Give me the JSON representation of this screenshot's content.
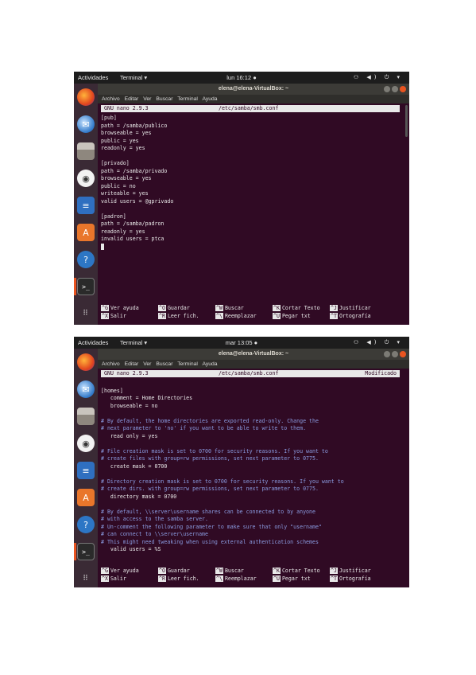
{
  "screens": [
    {
      "topbar": {
        "activities": "Actividades",
        "app_menu": "Terminal ▾",
        "clock": "lun 16:12 ●",
        "tray": "⚇ ◀) ⏻ ▾"
      },
      "window": {
        "title": "elena@elena-VirtualBox: ~"
      },
      "menubar": [
        "Archivo",
        "Editar",
        "Ver",
        "Buscar",
        "Terminal",
        "Ayuda"
      ],
      "nano": {
        "version": "GNU nano 2.9.3",
        "file": "/etc/samba/smb.conf",
        "status": "",
        "lines": [
          {
            "text": "[pub]",
            "comment": false
          },
          {
            "text": "path = /samba/publico",
            "comment": false
          },
          {
            "text": "browseable = yes",
            "comment": false
          },
          {
            "text": "public = yes",
            "comment": false
          },
          {
            "text": "readonly = yes",
            "comment": false
          },
          {
            "text": "",
            "comment": false
          },
          {
            "text": "[privado]",
            "comment": false
          },
          {
            "text": "path = /samba/privado",
            "comment": false
          },
          {
            "text": "browseable = yes",
            "comment": false
          },
          {
            "text": "public = no",
            "comment": false
          },
          {
            "text": "writeable = yes",
            "comment": false
          },
          {
            "text": "valid users = @gprivado",
            "comment": false
          },
          {
            "text": "",
            "comment": false
          },
          {
            "text": "[padron]",
            "comment": false
          },
          {
            "text": "path = /samba/padron",
            "comment": false
          },
          {
            "text": "readonly = yes",
            "comment": false
          },
          {
            "text": "invalid users = ptca",
            "comment": false
          }
        ],
        "cursor_after_last": true,
        "shortcuts": [
          {
            "key": "^G",
            "label": "Ver ayuda"
          },
          {
            "key": "^O",
            "label": "Guardar"
          },
          {
            "key": "^W",
            "label": "Buscar"
          },
          {
            "key": "^K",
            "label": "Cortar Texto"
          },
          {
            "key": "^J",
            "label": "Justificar"
          },
          {
            "key": "^X",
            "label": "Salir"
          },
          {
            "key": "^R",
            "label": "Leer fich."
          },
          {
            "key": "^\\",
            "label": "Reemplazar"
          },
          {
            "key": "^U",
            "label": "Pegar txt"
          },
          {
            "key": "^T",
            "label": "Ortografía"
          }
        ]
      }
    },
    {
      "topbar": {
        "activities": "Actividades",
        "app_menu": "Terminal ▾",
        "clock": "mar 13:05 ●",
        "tray": "⚇ ◀) ⏻ ▾"
      },
      "window": {
        "title": "elena@elena-VirtualBox: ~"
      },
      "menubar": [
        "Archivo",
        "Editar",
        "Ver",
        "Buscar",
        "Terminal",
        "Ayuda"
      ],
      "nano": {
        "version": "GNU nano 2.9.3",
        "file": "/etc/samba/smb.conf",
        "status": "Modificado",
        "lines": [
          {
            "text": "",
            "comment": false
          },
          {
            "text": "[homes]",
            "comment": false
          },
          {
            "text": "   comment = Home Directories",
            "comment": false
          },
          {
            "text": "   browseable = no",
            "comment": false
          },
          {
            "text": "",
            "comment": false
          },
          {
            "text": "# By default, the home directories are exported read-only. Change the",
            "comment": true
          },
          {
            "text": "# next parameter to 'no' if you want to be able to write to them.",
            "comment": true
          },
          {
            "text": "   read only = yes",
            "comment": false
          },
          {
            "text": "",
            "comment": false
          },
          {
            "text": "# File creation mask is set to 0700 for security reasons. If you want to",
            "comment": true
          },
          {
            "text": "# create files with group=rw permissions, set next parameter to 0775.",
            "comment": true
          },
          {
            "text": "   create mask = 0700",
            "comment": false
          },
          {
            "text": "",
            "comment": false
          },
          {
            "text": "# Directory creation mask is set to 0700 for security reasons. If you want to",
            "comment": true
          },
          {
            "text": "# create dirs. with group=rw permissions, set next parameter to 0775.",
            "comment": true
          },
          {
            "text": "   directory mask = 0700",
            "comment": false
          },
          {
            "text": "",
            "comment": false
          },
          {
            "text": "# By default, \\\\server\\username shares can be connected to by anyone",
            "comment": true
          },
          {
            "text": "# with access to the samba server.",
            "comment": true
          },
          {
            "text": "# Un-comment the following parameter to make sure that only \"username\"",
            "comment": true
          },
          {
            "text": "# can connect to \\\\server\\username",
            "comment": true
          },
          {
            "text": "# This might need tweaking when using external authentication schemes",
            "comment": true
          },
          {
            "text": "   valid users = %S",
            "comment": false
          }
        ],
        "cursor_after_last": false,
        "shortcuts": [
          {
            "key": "^G",
            "label": "Ver ayuda"
          },
          {
            "key": "^O",
            "label": "Guardar"
          },
          {
            "key": "^W",
            "label": "Buscar"
          },
          {
            "key": "^K",
            "label": "Cortar Texto"
          },
          {
            "key": "^J",
            "label": "Justificar"
          },
          {
            "key": "^X",
            "label": "Salir"
          },
          {
            "key": "^R",
            "label": "Leer fich."
          },
          {
            "key": "^\\",
            "label": "Reemplazar"
          },
          {
            "key": "^U",
            "label": "Pegar txt"
          },
          {
            "key": "^T",
            "label": "Ortografía"
          }
        ]
      }
    }
  ],
  "dock": [
    "firefox-icon",
    "thunderbird-icon",
    "files-icon",
    "rhythmbox-icon",
    "writer-icon",
    "software-icon",
    "help-icon",
    "terminal-icon",
    "app-grid-icon"
  ],
  "colors": {
    "terminal_bg": "#300a24",
    "accent": "#e95420",
    "comment": "#8a9be0"
  }
}
